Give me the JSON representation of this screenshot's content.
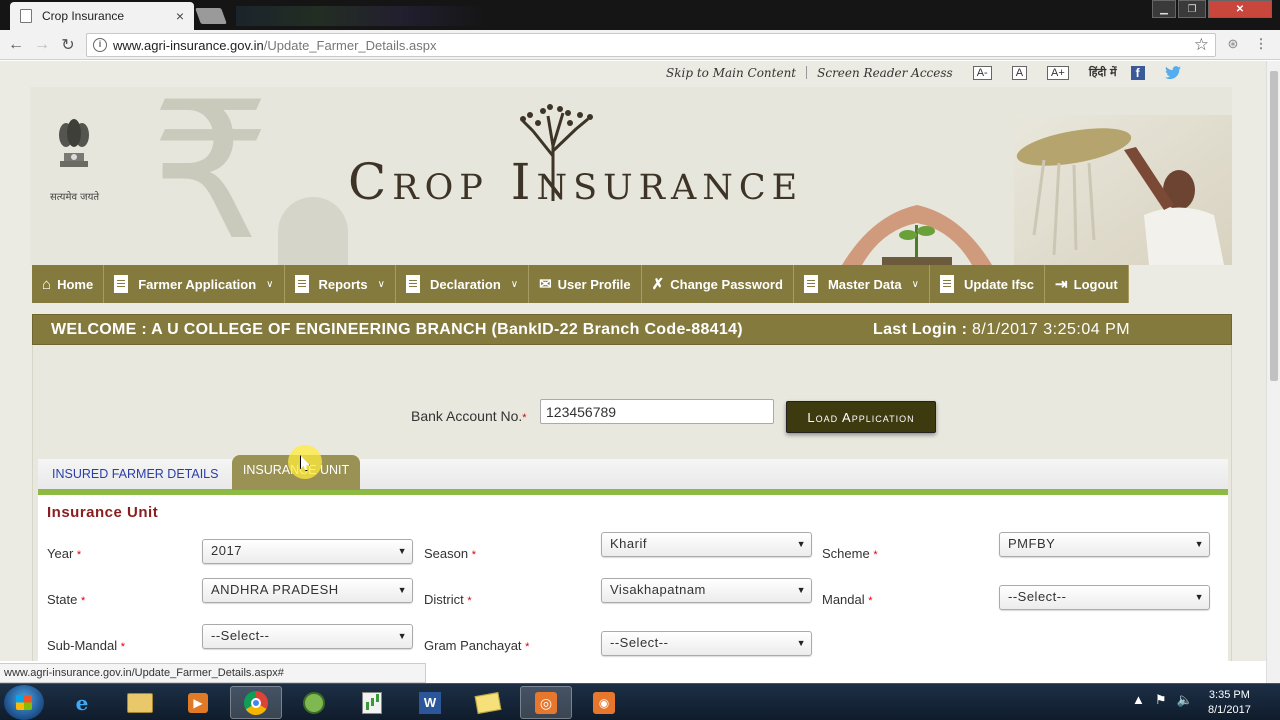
{
  "browser": {
    "tab_title": "Crop Insurance",
    "tab_close": "×",
    "url_host": "www.agri-insurance.gov.in",
    "url_path": "/Update_Farmer_Details.aspx"
  },
  "utility": {
    "skip_link": "Skip to Main Content",
    "screen_reader": "Screen Reader Access",
    "font_small": "A-",
    "font_normal": "A",
    "font_large": "A+",
    "hindi": "हिंदी में",
    "facebook_glyph": "f",
    "twitter_glyph": "t"
  },
  "header": {
    "site_title": "Crop Insurance",
    "motto": "सत्यमेव जयते",
    "rupee_glyph": "₹"
  },
  "menu": {
    "items": [
      {
        "label": "Home"
      },
      {
        "label": "Farmer Application"
      },
      {
        "label": "Reports"
      },
      {
        "label": "Declaration"
      },
      {
        "label": "User Profile"
      },
      {
        "label": "Change Password"
      },
      {
        "label": "Master Data"
      },
      {
        "label": "Update Ifsc"
      },
      {
        "label": "Logout"
      }
    ]
  },
  "welcome": {
    "text": "WELCOME : A U COLLEGE OF ENGINEERING BRANCH (BankID-22 Branch Code-88414)",
    "last_login_label": "Last Login :",
    "last_login_value": "8/1/2017 3:25:04 PM"
  },
  "account": {
    "label": "Bank Account No.",
    "required": "*",
    "value": "123456789",
    "load_button": "Load Application"
  },
  "tabs": {
    "insured_farmer": "INSURED FARMER DETAILS",
    "insurance_unit": "INSURANCE UNIT"
  },
  "form": {
    "title": "Insurance Unit",
    "fields": {
      "year": {
        "label": "Year",
        "value": "2017"
      },
      "season": {
        "label": "Season",
        "value": "Kharif"
      },
      "scheme": {
        "label": "Scheme",
        "value": "PMFBY"
      },
      "state": {
        "label": "State",
        "value": "ANDHRA PRADESH"
      },
      "district": {
        "label": "District",
        "value": "Visakhapatnam"
      },
      "mandal": {
        "label": "Mandal",
        "value": "--Select--"
      },
      "sub_mandal": {
        "label": "Sub-Mandal",
        "value": "--Select--"
      },
      "gram_panchayat": {
        "label": "Gram Panchayat",
        "value": "--Select--"
      }
    }
  },
  "status_url": "www.agri-insurance.gov.in/Update_Farmer_Details.aspx#",
  "taskbar": {
    "time": "3:35 PM",
    "date": "8/1/2017"
  },
  "colors": {
    "menu_bg": "#847a3e",
    "load_button_bg": "#3d3a10",
    "tab_active_bg": "#9a9155",
    "tab_underline": "#8dba43",
    "form_title": "#8a1e1e",
    "tab_link": "#2b3ea8"
  }
}
